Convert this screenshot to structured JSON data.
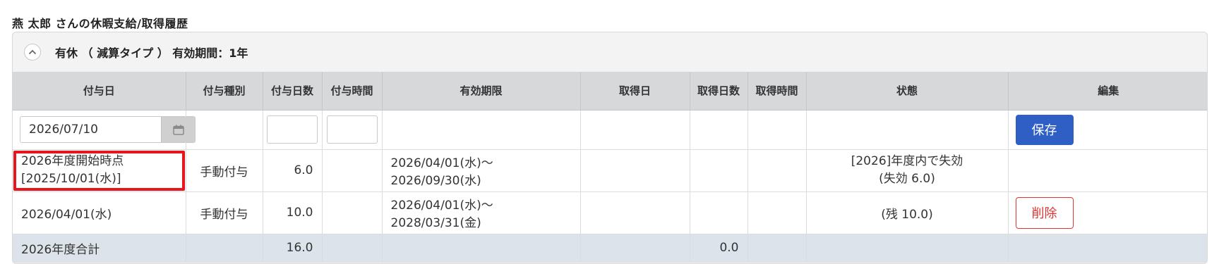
{
  "page_title": "燕 太郎 さんの休暇支給/取得履歴",
  "panel": {
    "title": "有休 （ 減算タイプ ） 有効期間：1年"
  },
  "table": {
    "headers": [
      "付与日",
      "付与種別",
      "付与日数",
      "付与時間",
      "有効期限",
      "取得日",
      "取得日数",
      "取得時間",
      "状態",
      "編集"
    ],
    "edit_row": {
      "grant_date_value": "2026/07/10",
      "grant_days_value": "",
      "grant_hours_value": "",
      "save_label": "保存"
    },
    "rows": [
      {
        "grant_date_line1": "2026年度開始時点",
        "grant_date_line2": "[2025/10/01(水)]",
        "grant_type": "手動付与",
        "grant_days": "6.0",
        "grant_hours": "",
        "validity": "2026/04/01(水)～2026/09/30(水)",
        "acquired_date": "",
        "acquired_days": "",
        "acquired_hours": "",
        "status_line1": "[2026]年度内で失効",
        "status_line2": "(失効 6.0)"
      },
      {
        "grant_date": "2026/04/01(水)",
        "grant_type": "手動付与",
        "grant_days": "10.0",
        "grant_hours": "",
        "validity": "2026/04/01(水)～2028/03/31(金)",
        "acquired_date": "",
        "acquired_days": "",
        "acquired_hours": "",
        "status": "(残 10.0)",
        "delete_label": "削除"
      }
    ],
    "total_row": {
      "label": "2026年度合計",
      "grant_days": "16.0",
      "acquired_days": "0.0"
    }
  },
  "colors": {
    "header_bg": "#d6d8da",
    "total_bg": "#dde3ea",
    "save_button": "#2f5fc4",
    "delete_button": "#e03434",
    "highlight": "#e8141e"
  },
  "icons": {
    "collapse": "chevron-up-icon",
    "calendar": "calendar-icon"
  }
}
